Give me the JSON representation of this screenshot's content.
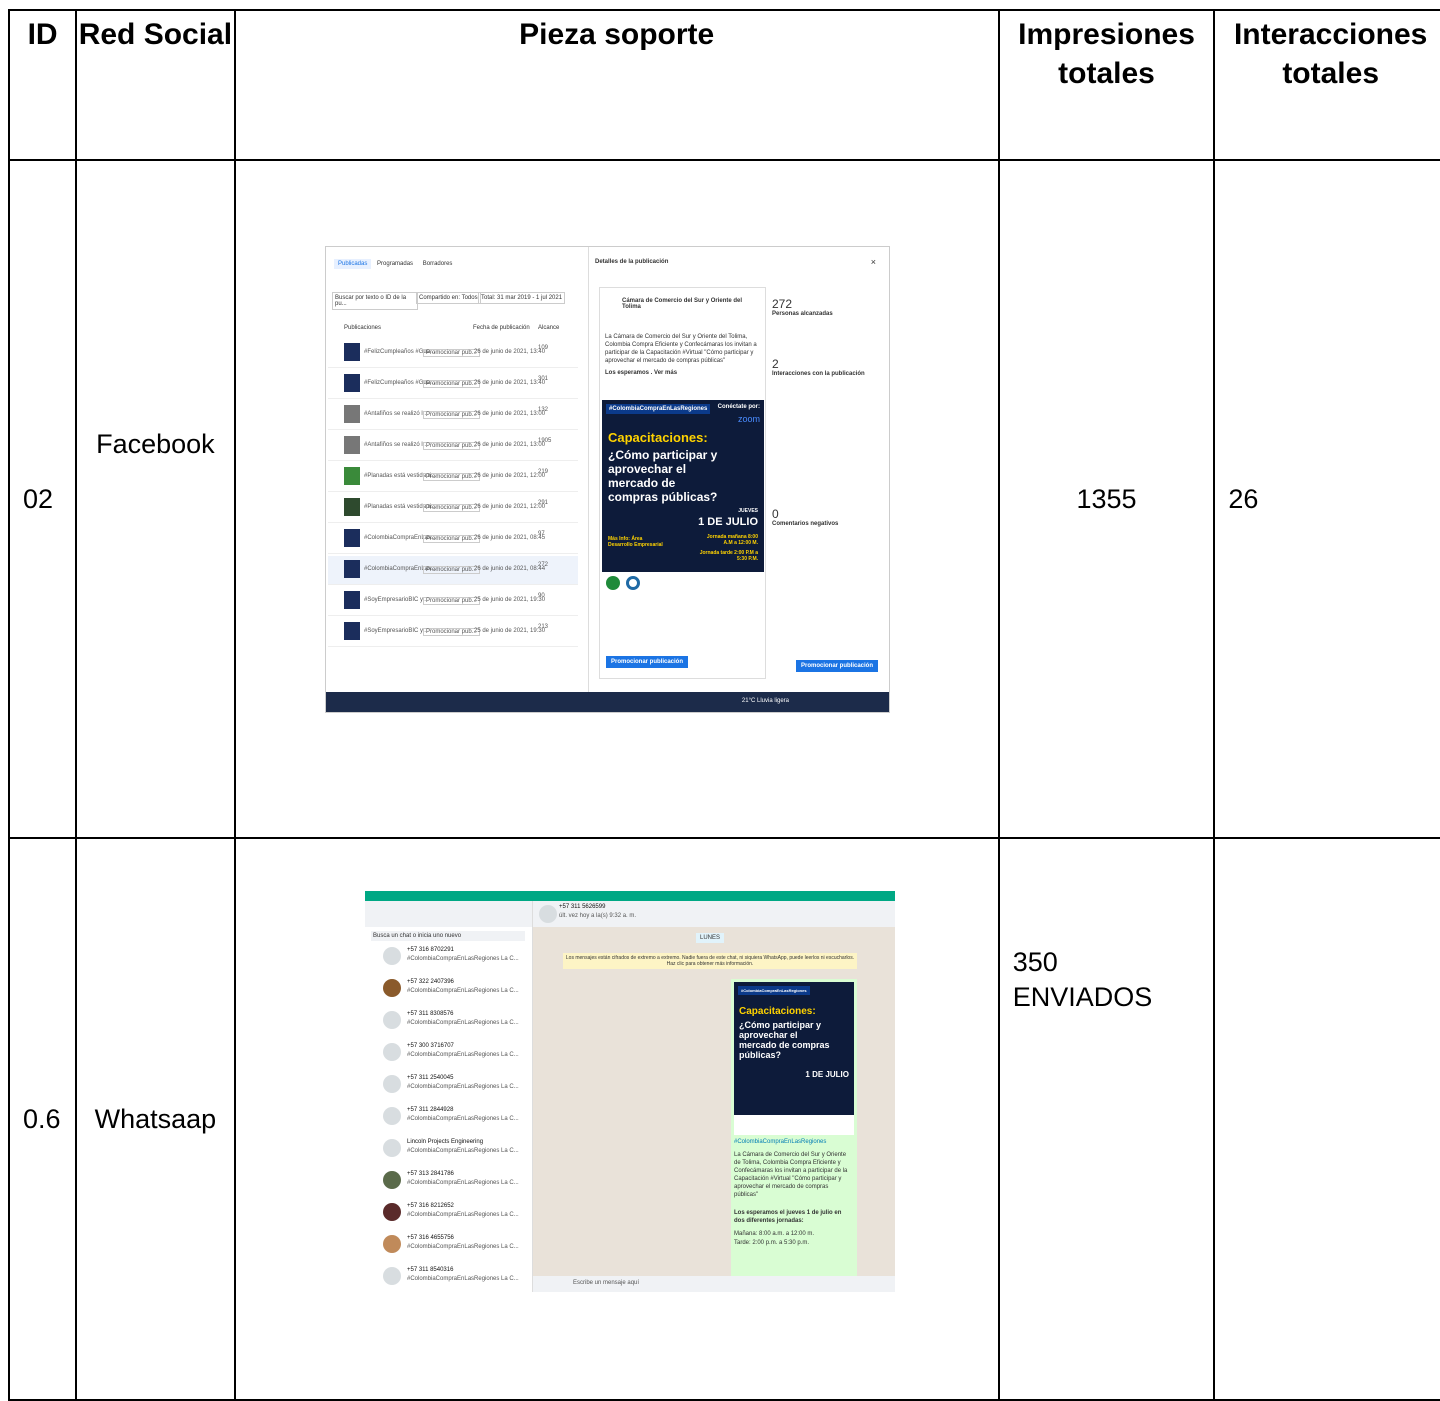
{
  "headers": {
    "id": "ID",
    "red_social": "Red Social",
    "pieza": "Pieza soporte",
    "impresiones": "Impresiones totales",
    "interacciones": "Interacciones totales"
  },
  "rows": [
    {
      "id": "02",
      "red_social": "Facebook",
      "impresiones": "1355",
      "interacciones": "26"
    },
    {
      "id": "0.6",
      "red_social": "Whatsaap",
      "impresiones": "350 ENVIADOS",
      "interacciones": ""
    }
  ],
  "facebook_screenshot": {
    "tabs": [
      "Publicadas",
      "Programadas",
      "Borradores"
    ],
    "search_placeholder": "Buscar por texto o ID de la pu...",
    "filter": "Compartido en: Todos",
    "date_range": "Total: 31 mar 2019 - 1 jul 2021",
    "columns": [
      "Publicaciones",
      "Fecha de publicación",
      "Alcance"
    ],
    "posts": [
      {
        "text": "#FelizCumpleaños #Gua...",
        "date": "26 de junio de 2021, 13:40",
        "reach": "109"
      },
      {
        "text": "#FelizCumpleaños #Gua...",
        "date": "26 de junio de 2021, 13:40",
        "reach": "301"
      },
      {
        "text": "#Antafiños se realizó l...",
        "date": "26 de junio de 2021, 13:00",
        "reach": "132"
      },
      {
        "text": "#Antafiños se realizó l...",
        "date": "26 de junio de 2021, 13:00",
        "reach": "1905"
      },
      {
        "text": "#Planadas está vestida d...",
        "date": "26 de junio de 2021, 12:00",
        "reach": "219"
      },
      {
        "text": "#Planadas está vestida d...",
        "date": "26 de junio de 2021, 12:00",
        "reach": "291"
      },
      {
        "text": "#ColombiaCompraEnLas...",
        "date": "26 de junio de 2021, 08:45",
        "reach": "97"
      },
      {
        "text": "#ColombiaCompraEnLas...",
        "date": "26 de junio de 2021, 08:44",
        "reach": "272"
      },
      {
        "text": "#SoyEmpresarioBIC y...",
        "date": "25 de junio de 2021, 19:30",
        "reach": "90"
      },
      {
        "text": "#SoyEmpresarioBIC y...",
        "date": "25 de junio de 2021, 19:30",
        "reach": "213"
      }
    ],
    "promote_label": "Promocionar pub...",
    "reach_caption": "Personas alcanzadas",
    "details_title": "Detalles de la publicación",
    "page_name": "Cámara de Comercio del Sur y Oriente del Tolima",
    "post_body": "La Cámara de Comercio del Sur y Oriente del Tolima, Colombia Compra Eficiente y Confecámaras los invitan a participar de la Capacitación #Virtual \"Cómo participar y aprovechar el mercado de compras públicas\"",
    "post_more": "Los esperamos . Ver más",
    "stats": {
      "reach": "272",
      "reach_label": "Personas alcanzadas",
      "interactions": "2",
      "interactions_label": "Interacciones con la publicación",
      "negative": "0",
      "negative_label": "Comentarios negativos"
    },
    "promote_button": "Promocionar publicación",
    "taskbar_weather": "21°C Lluvia ligera"
  },
  "poster": {
    "hashtag": "#ColombiaCompraEnLasRegiones",
    "connect": "Conéctate por:",
    "zoom": "zoom",
    "title": "Capacitaciones:",
    "question": "¿Cómo participar y aprovechar el mercado de compras públicas?",
    "weekday": "JUEVES",
    "date": "1 DE JULIO",
    "morning": "Jornada mañana 8:00 A.M a 12:00 M.",
    "afternoon": "Jornada tarde 2:00 P.M a 5:30 P.M.",
    "info": "Más Info: Área Desarrollo Empresarial"
  },
  "whatsapp_screenshot": {
    "contact": "+57 311 5626599",
    "last_seen": "últ. vez hoy a la(s) 9:32 a. m.",
    "search_placeholder": "Busca un chat o inicia uno nuevo",
    "day_label": "LUNES",
    "encryption_notice": "Los mensajes están cifrados de extremo a extremo. Nadie fuera de este chat, ni siquiera WhatsApp, puede leerlos ni escucharlos. Haz clic para obtener más información.",
    "chats": [
      "+57 316 8702291",
      "+57 322 2407396",
      "+57 311 8308576",
      "+57 300 3716707",
      "+57 311 2540045",
      "+57 311 2844928",
      "Lincoln Projects Engineering",
      "+57 313 2841786",
      "+57 316 8212652",
      "+57 316 4655756",
      "+57 311 8540316"
    ],
    "chat_preview": "#ColombiaCompraEnLasRegiones La C...",
    "chat_time": "lunes",
    "message_hashtag": "#ColombiaCompraEnLasRegiones",
    "message_body": "La Cámara de Comercio del Sur y Oriente de Tolima, Colombia Compra Eficiente y Confecámaras los invitan a participar de la Capacitación #Virtual \"Cómo participar y aprovechar el mercado de compras públicas\"",
    "message_schedule": "Los esperamos el jueves 1 de julio en dos diferentes jornadas:",
    "message_morning": "Mañana: 8:00 a.m. a 12:00 m.",
    "message_afternoon": "Tarde: 2:00 p.m. a 5:30 p.m.",
    "compose_placeholder": "Escribe un mensaje aquí"
  }
}
